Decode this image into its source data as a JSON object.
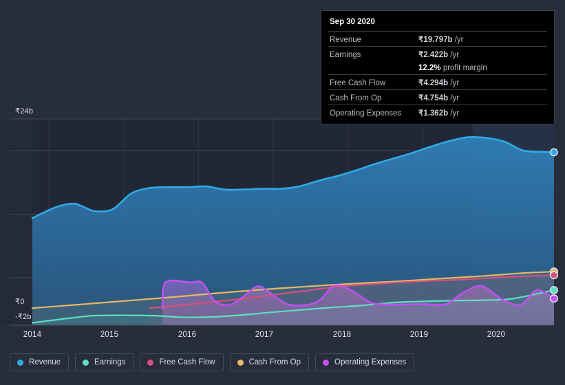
{
  "chart_data": {
    "type": "area",
    "title": "",
    "xlabel": "",
    "ylabel": "",
    "currency_symbol": "₹",
    "ylim": [
      -2,
      24
    ],
    "y_ticks": [
      {
        "label": "₹24b",
        "value": 24
      },
      {
        "label": "₹0",
        "value": 0
      },
      {
        "label": "-₹2b",
        "value": -2
      }
    ],
    "x_ticks": [
      "2014",
      "2015",
      "2016",
      "2017",
      "2018",
      "2019",
      "2020"
    ],
    "x_range": [
      2013.78,
      2020.75
    ],
    "grid": true,
    "legend_position": "bottom",
    "zero_line": true,
    "highlight_band": {
      "from": 2019.66,
      "to": 2020.75
    },
    "series": [
      {
        "name": "Revenue",
        "color": "#2eaae6",
        "fill": true,
        "x": [
          2013.78,
          2014.1,
          2014.35,
          2014.6,
          2014.85,
          2015.1,
          2015.35,
          2015.6,
          2015.85,
          2016.1,
          2016.35,
          2016.6,
          2016.85,
          2017.1,
          2017.35,
          2017.6,
          2017.85,
          2018.1,
          2018.35,
          2018.6,
          2018.85,
          2019.1,
          2019.35,
          2019.6,
          2019.85,
          2020.1,
          2020.35,
          2020.75
        ],
        "values": [
          11.5,
          12.9,
          13.3,
          12.4,
          12.6,
          14.6,
          15.3,
          15.4,
          15.4,
          15.5,
          15.1,
          15.1,
          15.2,
          15.2,
          15.5,
          16.2,
          16.8,
          17.5,
          18.3,
          19.0,
          19.7,
          20.5,
          21.2,
          21.7,
          21.6,
          21.1,
          20.0,
          19.797
        ]
      },
      {
        "name": "Earnings",
        "color": "#5ce0c0",
        "fill": false,
        "x": [
          2013.78,
          2014.2,
          2014.6,
          2015.0,
          2015.4,
          2015.8,
          2016.2,
          2016.6,
          2017.0,
          2017.4,
          2017.8,
          2018.2,
          2018.6,
          2019.0,
          2019.4,
          2019.8,
          2020.2,
          2020.75
        ],
        "values": [
          -1.7,
          -1.2,
          -0.8,
          -0.75,
          -0.8,
          -1.0,
          -0.95,
          -0.7,
          -0.35,
          -0.05,
          0.25,
          0.5,
          0.85,
          1.0,
          1.1,
          1.15,
          1.35,
          2.422
        ]
      },
      {
        "name": "Free Cash Flow",
        "color": "#d94f7a",
        "fill": false,
        "x": [
          2015.35,
          2015.8,
          2016.2,
          2016.6,
          2017.0,
          2017.4,
          2017.8,
          2018.2,
          2018.6,
          2019.0,
          2019.4,
          2019.8,
          2020.2,
          2020.75
        ],
        "values": [
          0.15,
          0.55,
          0.95,
          1.35,
          1.85,
          2.3,
          2.8,
          3.1,
          3.35,
          3.55,
          3.7,
          3.9,
          4.1,
          4.294
        ]
      },
      {
        "name": "Cash From Op",
        "color": "#e8b863",
        "fill": false,
        "x": [
          2013.78,
          2014.4,
          2015.0,
          2015.6,
          2016.2,
          2016.8,
          2017.4,
          2018.0,
          2018.6,
          2019.2,
          2019.8,
          2020.3,
          2020.75
        ],
        "values": [
          0.15,
          0.6,
          1.05,
          1.5,
          2.0,
          2.45,
          2.85,
          3.2,
          3.5,
          3.85,
          4.2,
          4.55,
          4.754
        ]
      },
      {
        "name": "Operating Expenses",
        "color": "#c050f0",
        "fill": true,
        "x": [
          2015.52,
          2015.56,
          2015.9,
          2016.05,
          2016.22,
          2016.42,
          2016.6,
          2016.8,
          2017.0,
          2017.2,
          2017.45,
          2017.62,
          2017.82,
          2018.05,
          2018.3,
          2018.52,
          2018.75,
          2019.0,
          2019.3,
          2019.52,
          2019.78,
          2020.05,
          2020.3,
          2020.52,
          2020.75
        ],
        "values": [
          0.0,
          3.4,
          3.4,
          3.35,
          1.0,
          0.55,
          1.6,
          2.9,
          1.75,
          0.6,
          0.55,
          1.15,
          3.0,
          2.35,
          0.85,
          0.6,
          0.62,
          0.65,
          0.62,
          2.0,
          2.95,
          1.3,
          0.55,
          2.4,
          1.362
        ]
      }
    ]
  },
  "tooltip": {
    "title": "Sep 30 2020",
    "rows": [
      {
        "key": "Revenue",
        "amount": "₹19.797b",
        "unit": "/yr",
        "color": "#3aa9e0"
      },
      {
        "key": "Earnings",
        "amount": "₹2.422b",
        "unit": "/yr",
        "color": "#4fd6b4"
      },
      {
        "key": "Free Cash Flow",
        "amount": "₹4.294b",
        "unit": "/yr",
        "color": "#e0457a"
      },
      {
        "key": "Cash From Op",
        "amount": "₹4.754b",
        "unit": "/yr",
        "color": "#e2a93f"
      },
      {
        "key": "Operating Expenses",
        "amount": "₹1.362b",
        "unit": "/yr",
        "color": "#bb52f0"
      }
    ],
    "profit_margin_value": "12.2%",
    "profit_margin_label": "profit margin"
  },
  "legend": {
    "items": [
      {
        "label": "Revenue",
        "color": "#2eaae6"
      },
      {
        "label": "Earnings",
        "color": "#5ce0c0"
      },
      {
        "label": "Free Cash Flow",
        "color": "#d94f7a"
      },
      {
        "label": "Cash From Op",
        "color": "#e8b863"
      },
      {
        "label": "Operating Expenses",
        "color": "#c050f0"
      }
    ]
  },
  "theme": {
    "background": "#282d3b",
    "plot_background": "#222736",
    "grid_color": "#3d4354",
    "zero_line_color": "#ffffff",
    "tooltip_background": "#000000"
  }
}
